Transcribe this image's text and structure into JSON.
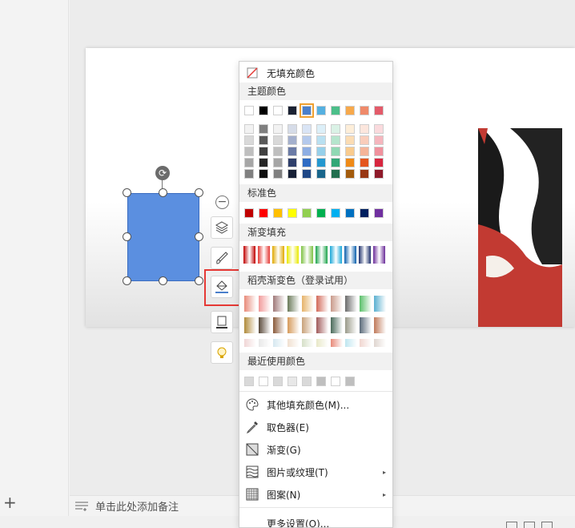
{
  "notes": {
    "placeholder": "单击此处添加备注"
  },
  "menu": {
    "no_fill": "无填充颜色",
    "theme_colors_label": "主题颜色",
    "standard_colors_label": "标准色",
    "gradient_fill_label": "渐变填充",
    "docer_gradient_label": "稻壳渐变色（登录试用）",
    "recent_colors_label": "最近使用颜色",
    "items": [
      {
        "label": "其他填充颜色(M)...",
        "icon": "palette-icon",
        "arrow": false
      },
      {
        "label": "取色器(E)",
        "icon": "eyedropper-icon",
        "arrow": false
      },
      {
        "label": "渐变(G)",
        "icon": "gradient-icon",
        "arrow": true
      },
      {
        "label": "图片或纹理(T)",
        "icon": "texture-icon",
        "arrow": true
      },
      {
        "label": "图案(N)",
        "icon": "pattern-icon",
        "arrow": true
      },
      {
        "label": "更多设置(O)...",
        "icon": "",
        "arrow": false
      }
    ],
    "theme_top": [
      "#ffffff",
      "#000000",
      "#ffffff",
      "#1b2233",
      "#4a7fcb",
      "#55b0e0",
      "#4cbf8a",
      "#f7a94c",
      "#ef8a6a",
      "#e35b6a"
    ],
    "theme_grid": [
      [
        "#f2f2f2",
        "#7f7f7f",
        "#f2f2f2",
        "#d6dce8",
        "#d9e4f5",
        "#dceff8",
        "#daf2e6",
        "#fdeed9",
        "#fce6dd",
        "#fadadd"
      ],
      [
        "#d9d9d9",
        "#595959",
        "#d9d9d9",
        "#a4b0cd",
        "#b4c9ec",
        "#b9e0f1",
        "#b5e5cd",
        "#fbdcb4",
        "#f9cdbb",
        "#f5b6be"
      ],
      [
        "#bfbfbf",
        "#404040",
        "#bfbfbf",
        "#6b7ba6",
        "#8eaee3",
        "#96d0ea",
        "#90d8b4",
        "#f9cb8e",
        "#f5b499",
        "#f0919d"
      ],
      [
        "#a6a6a6",
        "#262626",
        "#a6a6a6",
        "#2f3f6b",
        "#2f6cc4",
        "#2598cf",
        "#33a777",
        "#ef8a18",
        "#e4561f",
        "#d7263f"
      ],
      [
        "#808080",
        "#0d0d0d",
        "#808080",
        "#172036",
        "#1f4886",
        "#19668c",
        "#226f4f",
        "#a35b0d",
        "#983714",
        "#8f1a2a"
      ]
    ],
    "standard": [
      "#c00000",
      "#ff0000",
      "#ffc000",
      "#ffff00",
      "#92d050",
      "#00b050",
      "#00b0f0",
      "#0070c0",
      "#002060",
      "#7030a0"
    ],
    "gradient": [
      "#c00000",
      "#e53935",
      "#e0a800",
      "#e8e800",
      "#7dc142",
      "#1ba34a",
      "#19a7d8",
      "#0b5fad",
      "#1c2f6b",
      "#6a2c99"
    ],
    "docer_row1": [
      "#e88a7a",
      "#f29a9a",
      "#a07a7a",
      "#6a7a5a",
      "#e6b36a",
      "#d36a5a",
      "#c99a8a",
      "#6a6a6a",
      "#5ac06a",
      "#5ab0d0"
    ],
    "docer_row2": [
      "#b08a3a",
      "#5a4a3a",
      "#8a5a3a",
      "#d69a5a",
      "#c9a27a",
      "#a05a5a",
      "#4a6a5a",
      "#9a9a8a",
      "#5a6a7a",
      "#c07a5a"
    ],
    "docer_row3": [
      "#f0d6d6",
      "#e8e8e8",
      "#d6e8f0",
      "#f0e0d0",
      "#d6e0c8",
      "#e8e8c8",
      "#e88a7a",
      "#bfe6f0",
      "#f0d6d0",
      "#e0d6d0"
    ],
    "recent": [
      "#d9d9d9",
      "#ffffff",
      "#d9d9d9",
      "#e8e8e8",
      "#d9d9d9",
      "#bfbfbf",
      "#ffffff",
      "#bfbfbf"
    ]
  }
}
